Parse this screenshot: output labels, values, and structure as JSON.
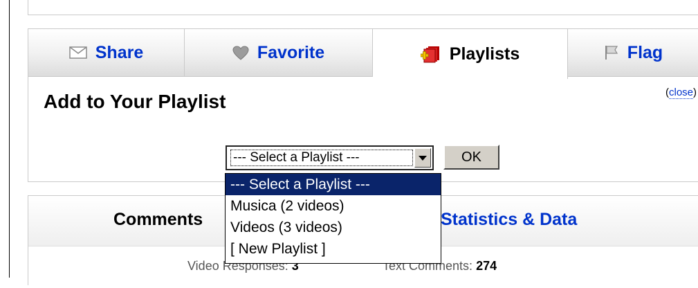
{
  "tabs": [
    {
      "label": "Share",
      "icon": "envelope-icon"
    },
    {
      "label": "Favorite",
      "icon": "heart-icon"
    },
    {
      "label": "Playlists",
      "icon": "playlist-add-icon"
    },
    {
      "label": "Flag",
      "icon": "flag-icon"
    }
  ],
  "active_tab": "Playlists",
  "panel": {
    "title": "Add to Your Playlist",
    "close_paren_open": "(",
    "close_label": "close",
    "close_paren_close": ")"
  },
  "playlist_select": {
    "selected_value": "--- Select a Playlist ---",
    "options": [
      "--- Select a Playlist ---",
      "Musica (2 videos)",
      "Videos (3 videos)",
      "[ New Playlist ]"
    ],
    "highlighted_index": 0
  },
  "ok_button_label": "OK",
  "lower_tabs": {
    "comments_label": "Comments",
    "stats_label": "Statistics & Data"
  },
  "stats": {
    "video_responses_label": "Video Responses:",
    "video_responses_value": "3",
    "text_comments_label": "Text Comments:",
    "text_comments_value": "274"
  },
  "colors": {
    "link": "#0033cc",
    "selection": "#0a246a",
    "border": "#c9c9c9"
  }
}
